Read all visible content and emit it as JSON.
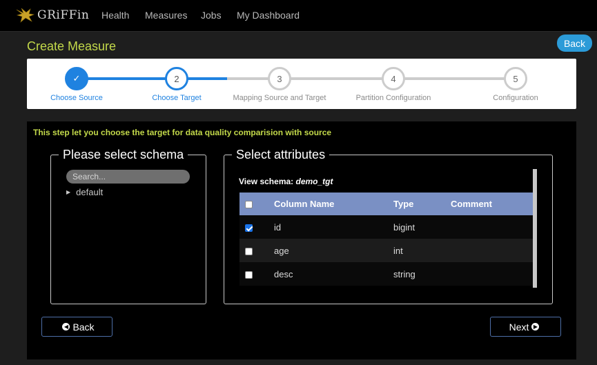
{
  "nav": {
    "brand": "GRiFFin",
    "links": [
      "Health",
      "Measures",
      "Jobs",
      "My Dashboard"
    ]
  },
  "page": {
    "title": "Create Measure",
    "back_label": "Back"
  },
  "steps": [
    {
      "number": "✓",
      "label": "Choose Source",
      "state": "done"
    },
    {
      "number": "2",
      "label": "Choose Target",
      "state": "active"
    },
    {
      "number": "3",
      "label": "Mapping Source and Target",
      "state": "todo"
    },
    {
      "number": "4",
      "label": "Partition Configuration",
      "state": "todo"
    },
    {
      "number": "5",
      "label": "Configuration",
      "state": "todo"
    }
  ],
  "hint": "This step let you choose the target for data quality comparision with source",
  "schema_panel": {
    "legend": "Please select schema",
    "search_placeholder": "Search...",
    "tree": [
      "default"
    ]
  },
  "attributes_panel": {
    "legend": "Select attributes",
    "view_label": "View schema:",
    "schema_name": "demo_tgt",
    "columns": [
      "Column Name",
      "Type",
      "Comment"
    ],
    "rows": [
      {
        "name": "id",
        "type": "bigint",
        "comment": "",
        "checked": true
      },
      {
        "name": "age",
        "type": "int",
        "comment": "",
        "checked": false
      },
      {
        "name": "desc",
        "type": "string",
        "comment": "",
        "checked": false
      }
    ]
  },
  "footer": {
    "back_label": "Back",
    "next_label": "Next"
  },
  "colors": {
    "accent_blue": "#1f82e0",
    "title_green": "#c3d94a",
    "table_header": "#7a90c4",
    "back_button": "#2c9bd8"
  }
}
